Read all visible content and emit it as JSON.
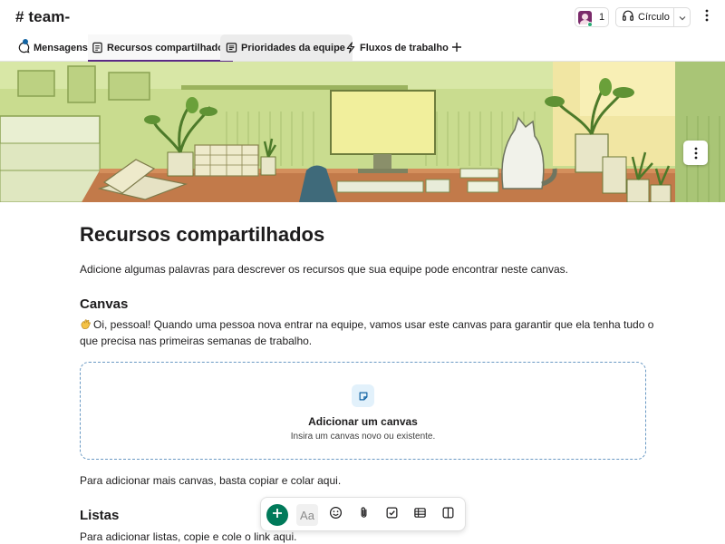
{
  "header": {
    "channel_name": "# team-",
    "member_count": "1",
    "huddle_label": "Círculo"
  },
  "tabs": [
    {
      "label": "Mensagens"
    },
    {
      "label": "Recursos compartilhados"
    },
    {
      "label": "Prioridades da equipe"
    },
    {
      "label": "Fluxos de trabalho"
    }
  ],
  "canvas": {
    "title": "Recursos compartilhados",
    "description": "Adicione algumas palavras para descrever os recursos que sua equipe pode encontrar neste canvas.",
    "section_canvas": "Canvas",
    "canvas_paragraph": "Oi, pessoal! Quando uma pessoa nova entrar na equipe, vamos usar este canvas para garantir que ela tenha tudo o que precisa nas primeiras semanas de trabalho.",
    "add_canvas_title": "Adicionar um canvas",
    "add_canvas_subtitle": "Insira um canvas novo ou existente.",
    "more_canvas_text": "Para adicionar mais canvas, basta copiar e colar aqui.",
    "section_lists": "Listas",
    "lists_text": "Para adicionar listas, copie e cole o link aqui."
  },
  "toolbar": {
    "text_format_label": "Aa"
  },
  "colors": {
    "accent_tab": "#5b2a86",
    "add_button": "#007a5a",
    "dropzone_border": "#6b9ac4",
    "presence": "#2bac76"
  }
}
